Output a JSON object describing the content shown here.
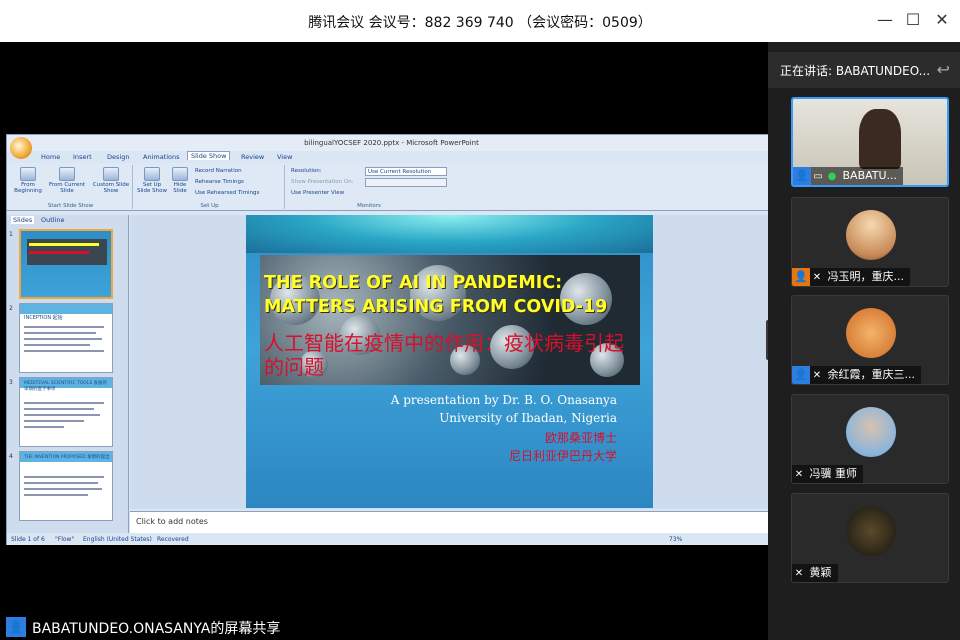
{
  "window": {
    "title": "腾讯会议  会议号：882 369 740  （会议密码：0509）",
    "controls": {
      "minimize": "—",
      "maximize": "☐",
      "close": "✕"
    }
  },
  "speaking": {
    "label": "正在讲话: BABATUNDEO....",
    "back_icon": "reply-arrow-icon"
  },
  "participants": [
    {
      "name": "BABATU...",
      "active": true
    },
    {
      "name": "冯玉明，重庆..."
    },
    {
      "name": "余红霞，重庆三..."
    },
    {
      "name": "冯骥 重师"
    },
    {
      "name": "黄颖"
    }
  ],
  "screen_share": {
    "label": "BABATUNDEO.ONASANYA的屏幕共享"
  },
  "ppt": {
    "title": "bilingualYOCSEF 2020.pptx - Microsoft PowerPoint",
    "tabs": [
      "Home",
      "Insert",
      "Design",
      "Animations",
      "Slide Show",
      "Review",
      "View"
    ],
    "selected_tab": "Slide Show",
    "ribbon": {
      "from_beginning": "From Beginning",
      "from_current": "From Current Slide",
      "custom_show": "Custom Slide Show",
      "group_start": "Start Slide Show",
      "setup_show": "Set Up Slide Show",
      "hide_slide": "Hide Slide",
      "record_narration": "Record Narration",
      "rehearse_timings": "Rehearse Timings",
      "use_rehearsed": "Use Rehearsed Timings",
      "group_setup": "Set Up",
      "resolution_label": "Resolution:",
      "resolution_value": "Use Current Resolution",
      "show_on_label": "Show Presentation On:",
      "presenter_view": "Use Presenter View",
      "group_monitors": "Monitors"
    },
    "pane_tabs": {
      "slides": "Slides",
      "outline": "Outline"
    },
    "thumbnails": [
      {
        "num": "1",
        "heading": ""
      },
      {
        "num": "2",
        "heading": "INCEPTION 起始"
      },
      {
        "num": "3",
        "heading": "MEDITEVAL SCIENTIFIC TOOLS 发展的早期的医学事项"
      },
      {
        "num": "4",
        "heading": "THE INVENTION PROPOSED 发明的提出"
      }
    ],
    "slide": {
      "title_en": "THE ROLE OF AI IN PANDEMIC: MATTERS ARISING FROM COVID-19",
      "title_cn": "人工智能在疫情中的作用：疫状病毒引起的问题",
      "presenter": "A presentation by Dr. B. O. Onasanya",
      "university": "University of Ibadan, Nigeria",
      "presenter_cn": "欧那桑亚博士",
      "university_cn": "尼日利亚伊巴丹大学"
    },
    "notes_placeholder": "Click to add notes",
    "status": {
      "slide": "Slide 1 of 6",
      "theme": "\"Flow\"",
      "language": "English (United States)",
      "recovered": "Recovered",
      "zoom": "73%"
    }
  },
  "colors": {
    "accent_blue": "#2f7de1",
    "title_yellow": "#ffff2a",
    "title_red": "#d8102b"
  }
}
